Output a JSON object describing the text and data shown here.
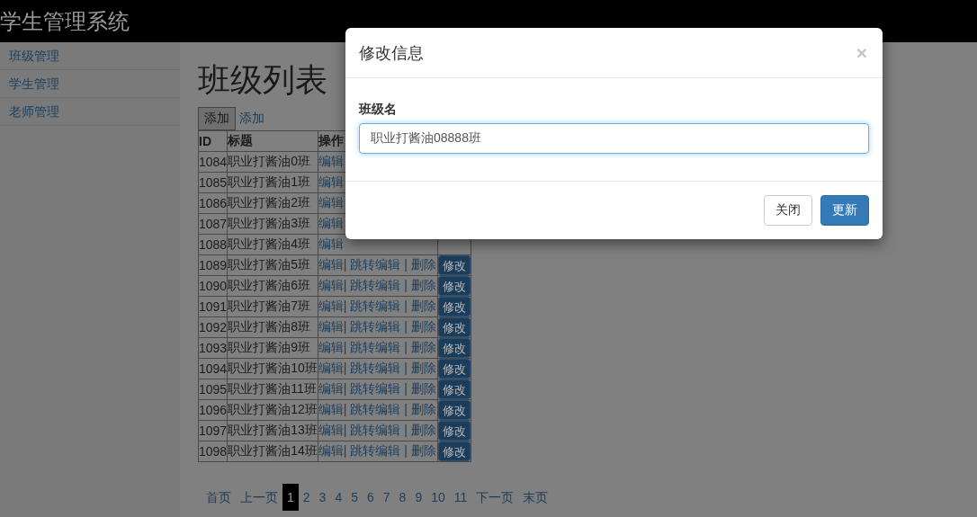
{
  "navbar": {
    "brand": "学生管理系统"
  },
  "sidebar": {
    "items": [
      {
        "label": "班级管理"
      },
      {
        "label": "学生管理"
      },
      {
        "label": "老师管理"
      }
    ]
  },
  "page": {
    "title": "班级列表",
    "add_button": "添加",
    "add_link": "添加"
  },
  "table": {
    "columns": [
      "ID",
      "标题",
      "操作"
    ],
    "action_separator": "|",
    "rows": [
      {
        "id": "1084",
        "title": "职业打酱油0班",
        "actions": [
          "编辑"
        ]
      },
      {
        "id": "1085",
        "title": "职业打酱油1班",
        "actions": [
          "编辑"
        ]
      },
      {
        "id": "1086",
        "title": "职业打酱油2班",
        "actions": [
          "编辑"
        ]
      },
      {
        "id": "1087",
        "title": "职业打酱油3班",
        "actions": [
          "编辑"
        ]
      },
      {
        "id": "1088",
        "title": "职业打酱油4班",
        "actions": [
          "编辑"
        ]
      },
      {
        "id": "1089",
        "title": "职业打酱油5班",
        "actions": [
          "编辑",
          "跳转编辑",
          "删除"
        ],
        "button": "修改"
      },
      {
        "id": "1090",
        "title": "职业打酱油6班",
        "actions": [
          "编辑",
          "跳转编辑",
          "删除"
        ],
        "button": "修改"
      },
      {
        "id": "1091",
        "title": "职业打酱油7班",
        "actions": [
          "编辑",
          "跳转编辑",
          "删除"
        ],
        "button": "修改"
      },
      {
        "id": "1092",
        "title": "职业打酱油8班",
        "actions": [
          "编辑",
          "跳转编辑",
          "删除"
        ],
        "button": "修改"
      },
      {
        "id": "1093",
        "title": "职业打酱油9班",
        "actions": [
          "编辑",
          "跳转编辑",
          "删除"
        ],
        "button": "修改"
      },
      {
        "id": "1094",
        "title": "职业打酱油10班",
        "actions": [
          "编辑",
          "跳转编辑",
          "删除"
        ],
        "button": "修改"
      },
      {
        "id": "1095",
        "title": "职业打酱油11班",
        "actions": [
          "编辑",
          "跳转编辑",
          "删除"
        ],
        "button": "修改"
      },
      {
        "id": "1096",
        "title": "职业打酱油12班",
        "actions": [
          "编辑",
          "跳转编辑",
          "删除"
        ],
        "button": "修改"
      },
      {
        "id": "1097",
        "title": "职业打酱油13班",
        "actions": [
          "编辑",
          "跳转编辑",
          "删除"
        ],
        "button": "修改"
      },
      {
        "id": "1098",
        "title": "职业打酱油14班",
        "actions": [
          "编辑",
          "跳转编辑",
          "删除"
        ],
        "button": "修改"
      }
    ]
  },
  "pagination": {
    "first": "首页",
    "prev": "上一页",
    "next": "下一页",
    "last": "末页",
    "pages": [
      {
        "label": "1",
        "selected": true
      },
      {
        "label": "2",
        "selected": false
      },
      {
        "label": "3",
        "selected": false
      },
      {
        "label": "4",
        "selected": false
      },
      {
        "label": "5",
        "selected": false
      },
      {
        "label": "6",
        "selected": false
      },
      {
        "label": "7",
        "selected": false
      },
      {
        "label": "8",
        "selected": false
      },
      {
        "label": "9",
        "selected": false
      },
      {
        "label": "10",
        "selected": false
      },
      {
        "label": "11",
        "selected": false
      }
    ]
  },
  "modal": {
    "title": "修改信息",
    "close": "×",
    "field": {
      "label": "班级名",
      "value": "职业打酱油08888班"
    },
    "buttons": [
      {
        "label": "关闭",
        "kind": "default"
      },
      {
        "label": "更新",
        "kind": "primary"
      }
    ]
  }
}
